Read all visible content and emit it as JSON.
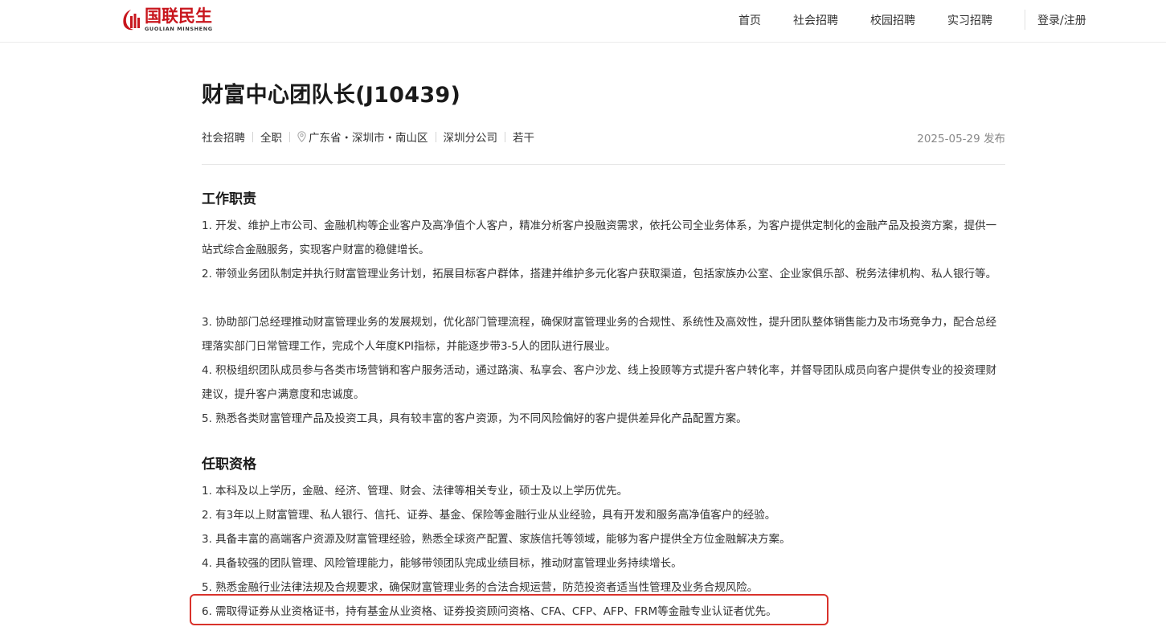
{
  "header": {
    "logo": {
      "cn": "国联民生",
      "en": "GUOLIAN MINSHENG",
      "brand_color": "#c8161d"
    },
    "nav": [
      {
        "label": "首页"
      },
      {
        "label": "社会招聘"
      },
      {
        "label": "校园招聘"
      },
      {
        "label": "实习招聘"
      }
    ],
    "login_label": "登录/注册"
  },
  "job": {
    "title": "财富中心团队长(J10439)",
    "meta": {
      "recruit_type": "社会招聘",
      "employment": "全职",
      "location": "广东省・深圳市・南山区",
      "branch": "深圳分公司",
      "headcount": "若干"
    },
    "published": "2025-05-29 发布"
  },
  "sections": {
    "duties": {
      "title": "工作职责",
      "items": [
        "1. 开发、维护上市公司、金融机构等企业客户及高净值个人客户，精准分析客户投融资需求，依托公司全业务体系，为客户提供定制化的金融产品及投资方案，提供一站式综合金融服务，实现客户财富的稳健增长。",
        "2. 带领业务团队制定并执行财富管理业务计划，拓展目标客户群体，搭建并维护多元化客户获取渠道，包括家族办公室、企业家俱乐部、税务法律机构、私人银行等。",
        "3. 协助部门总经理推动财富管理业务的发展规划，优化部门管理流程，确保财富管理业务的合规性、系统性及高效性，提升团队整体销售能力及市场竞争力，配合总经理落实部门日常管理工作，完成个人年度KPI指标，并能逐步带3-5人的团队进行展业。",
        "4. 积极组织团队成员参与各类市场营销和客户服务活动，通过路演、私享会、客户沙龙、线上投顾等方式提升客户转化率，并督导团队成员向客户提供专业的投资理财建议，提升客户满意度和忠诚度。",
        "5. 熟悉各类财富管理产品及投资工具，具有较丰富的客户资源，为不同风险偏好的客户提供差异化产品配置方案。"
      ]
    },
    "requirements": {
      "title": "任职资格",
      "items": [
        "1. 本科及以上学历，金融、经济、管理、财会、法律等相关专业，硕士及以上学历优先。",
        "2. 有3年以上财富管理、私人银行、信托、证券、基金、保险等金融行业从业经验，具有开发和服务高净值客户的经验。",
        "3. 具备丰富的高端客户资源及财富管理经验，熟悉全球资产配置、家族信托等领域，能够为客户提供全方位金融解决方案。",
        "4. 具备较强的团队管理、风险管理能力，能够带领团队完成业绩目标，推动财富管理业务持续增长。",
        "5. 熟悉金融行业法律法规及合规要求，确保财富管理业务的合法合规运营，防范投资者适当性管理及业务合规风险。",
        "6. 需取得证券从业资格证书，持有基金从业资格、证券投资顾问资格、CFA、CFP、AFP、FRM等金融专业认证者优先。"
      ]
    }
  },
  "annotation": {
    "highlight_color": "#d9322b"
  }
}
